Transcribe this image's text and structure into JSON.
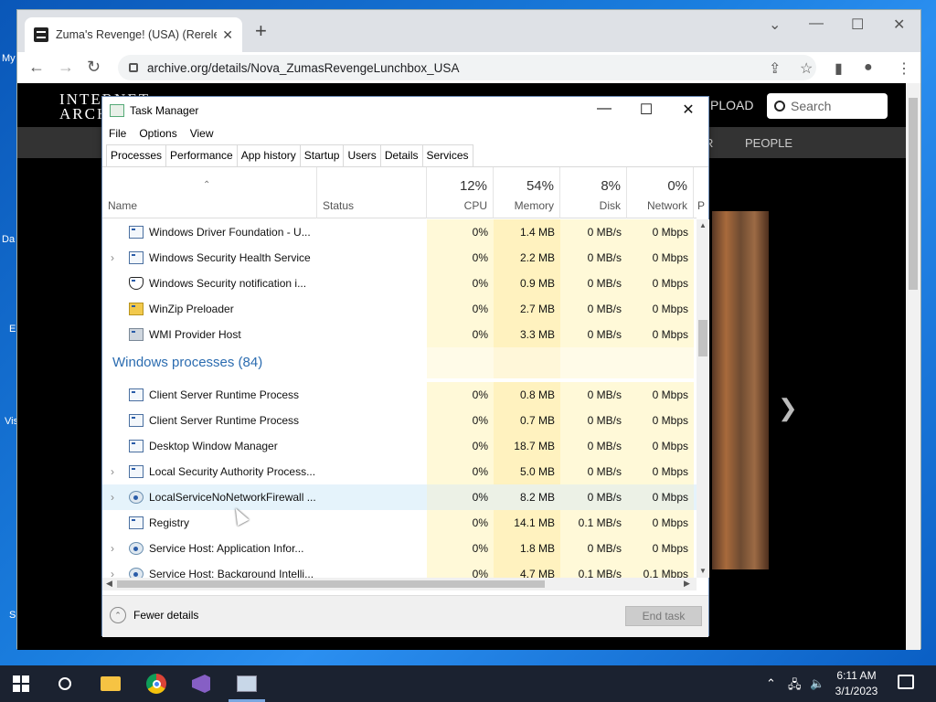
{
  "desktop": {
    "labels": [
      "My",
      "Da",
      "E",
      "Vis",
      "S"
    ]
  },
  "browser": {
    "tab_title": "Zuma's Revenge! (USA) (Rerelea...",
    "new_tab_icon": "plus-icon",
    "url": "archive.org/details/Nova_ZumasRevengeLunchbox_USA",
    "page": {
      "logo_line1": "INTERNET",
      "logo_line2": "ARCH",
      "upload_label": "PLOAD",
      "search_placeholder": "Search",
      "nav_item_r": "R",
      "nav_item_people": "PEOPLE",
      "next_arrow": "❯"
    }
  },
  "task_manager": {
    "title": "Task Manager",
    "menu": [
      "File",
      "Options",
      "View"
    ],
    "tabs": [
      "Processes",
      "Performance",
      "App history",
      "Startup",
      "Users",
      "Details",
      "Services"
    ],
    "columns": {
      "name": "Name",
      "status": "Status",
      "cpu_pct": "12%",
      "cpu": "CPU",
      "mem_pct": "54%",
      "mem": "Memory",
      "disk_pct": "8%",
      "disk": "Disk",
      "net_pct": "0%",
      "net": "Network",
      "power": "P"
    },
    "rows_top": [
      {
        "name": "Windows Driver Foundation - U...",
        "expand": "",
        "icon": "window",
        "cpu": "0%",
        "mem": "1.4 MB",
        "disk": "0 MB/s",
        "net": "0 Mbps"
      },
      {
        "name": "Windows Security Health Service",
        "expand": "›",
        "icon": "window",
        "cpu": "0%",
        "mem": "2.2 MB",
        "disk": "0 MB/s",
        "net": "0 Mbps"
      },
      {
        "name": "Windows Security notification i...",
        "expand": "",
        "icon": "shield",
        "cpu": "0%",
        "mem": "0.9 MB",
        "disk": "0 MB/s",
        "net": "0 Mbps"
      },
      {
        "name": "WinZip Preloader",
        "expand": "",
        "icon": "zip",
        "cpu": "0%",
        "mem": "2.7 MB",
        "disk": "0 MB/s",
        "net": "0 Mbps"
      },
      {
        "name": "WMI Provider Host",
        "expand": "",
        "icon": "wmi",
        "cpu": "0%",
        "mem": "3.3 MB",
        "disk": "0 MB/s",
        "net": "0 Mbps"
      }
    ],
    "group_label": "Windows processes (84)",
    "rows_bottom": [
      {
        "name": "Client Server Runtime Process",
        "expand": "",
        "icon": "window",
        "cpu": "0%",
        "mem": "0.8 MB",
        "disk": "0 MB/s",
        "net": "0 Mbps"
      },
      {
        "name": "Client Server Runtime Process",
        "expand": "",
        "icon": "window",
        "cpu": "0%",
        "mem": "0.7 MB",
        "disk": "0 MB/s",
        "net": "0 Mbps"
      },
      {
        "name": "Desktop Window Manager",
        "expand": "",
        "icon": "window",
        "cpu": "0%",
        "mem": "18.7 MB",
        "disk": "0 MB/s",
        "net": "0 Mbps"
      },
      {
        "name": "Local Security Authority Process...",
        "expand": "›",
        "icon": "window",
        "cpu": "0%",
        "mem": "5.0 MB",
        "disk": "0 MB/s",
        "net": "0 Mbps"
      },
      {
        "name": "LocalServiceNoNetworkFirewall ...",
        "expand": "›",
        "icon": "gear",
        "cpu": "0%",
        "mem": "8.2 MB",
        "disk": "0 MB/s",
        "net": "0 Mbps"
      },
      {
        "name": "Registry",
        "expand": "",
        "icon": "window",
        "cpu": "0%",
        "mem": "14.1 MB",
        "disk": "0.1 MB/s",
        "net": "0 Mbps"
      },
      {
        "name": "Service Host: Application Infor...",
        "expand": "›",
        "icon": "gear",
        "cpu": "0%",
        "mem": "1.8 MB",
        "disk": "0 MB/s",
        "net": "0 Mbps"
      },
      {
        "name": "Service Host: Background Intelli...",
        "expand": "›",
        "icon": "gear",
        "cpu": "0%",
        "mem": "4.7 MB",
        "disk": "0.1 MB/s",
        "net": "0.1 Mbps"
      }
    ],
    "fewer_details": "Fewer details",
    "end_task": "End task"
  },
  "taskbar": {
    "clock_time": "6:11 AM",
    "clock_date": "3/1/2023"
  }
}
